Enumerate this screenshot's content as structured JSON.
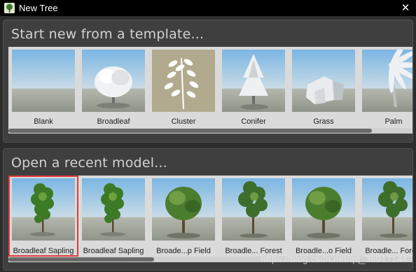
{
  "window": {
    "title": "New Tree",
    "icon": "tree-app-icon",
    "close_glyph": "✕"
  },
  "templates": {
    "heading": "Start new from a template...",
    "items": [
      {
        "label": "Blank",
        "icon": "blank-sky-thumbnail"
      },
      {
        "label": "Broadleaf",
        "icon": "broadleaf-tree-thumbnail"
      },
      {
        "label": "Cluster",
        "icon": "cluster-leaf-thumbnail"
      },
      {
        "label": "Conifer",
        "icon": "conifer-tree-thumbnail"
      },
      {
        "label": "Grass",
        "icon": "grass-thumbnail"
      },
      {
        "label": "Palm",
        "icon": "palm-tree-thumbnail"
      }
    ],
    "scroll_fraction": 0.9
  },
  "recent": {
    "heading": "Open a recent model...",
    "items": [
      {
        "label": "Broadleaf Sapling",
        "icon": "sapling-thumbnail",
        "selected": true
      },
      {
        "label": "Broadleaf Sapling",
        "icon": "sapling-thumbnail",
        "selected": false
      },
      {
        "label": "Broade...p Field",
        "icon": "broadleaf-field-thumbnail",
        "selected": false
      },
      {
        "label": "Broadle... Forest",
        "icon": "broadleaf-forest-thumbnail",
        "selected": false
      },
      {
        "label": "Broadle...o Field",
        "icon": "broadleaf-field-thumbnail",
        "selected": false
      },
      {
        "label": "Broadle... Forest",
        "icon": "broadleaf-forest-thumbnail",
        "selected": false
      }
    ],
    "scroll_fraction": 0.36
  },
  "watermark": "https://blog.csdn.net/qq_36917144",
  "colors": {
    "selection": "#e13a3a",
    "panel": "#3f3f3f",
    "background": "#2d2d2d"
  }
}
